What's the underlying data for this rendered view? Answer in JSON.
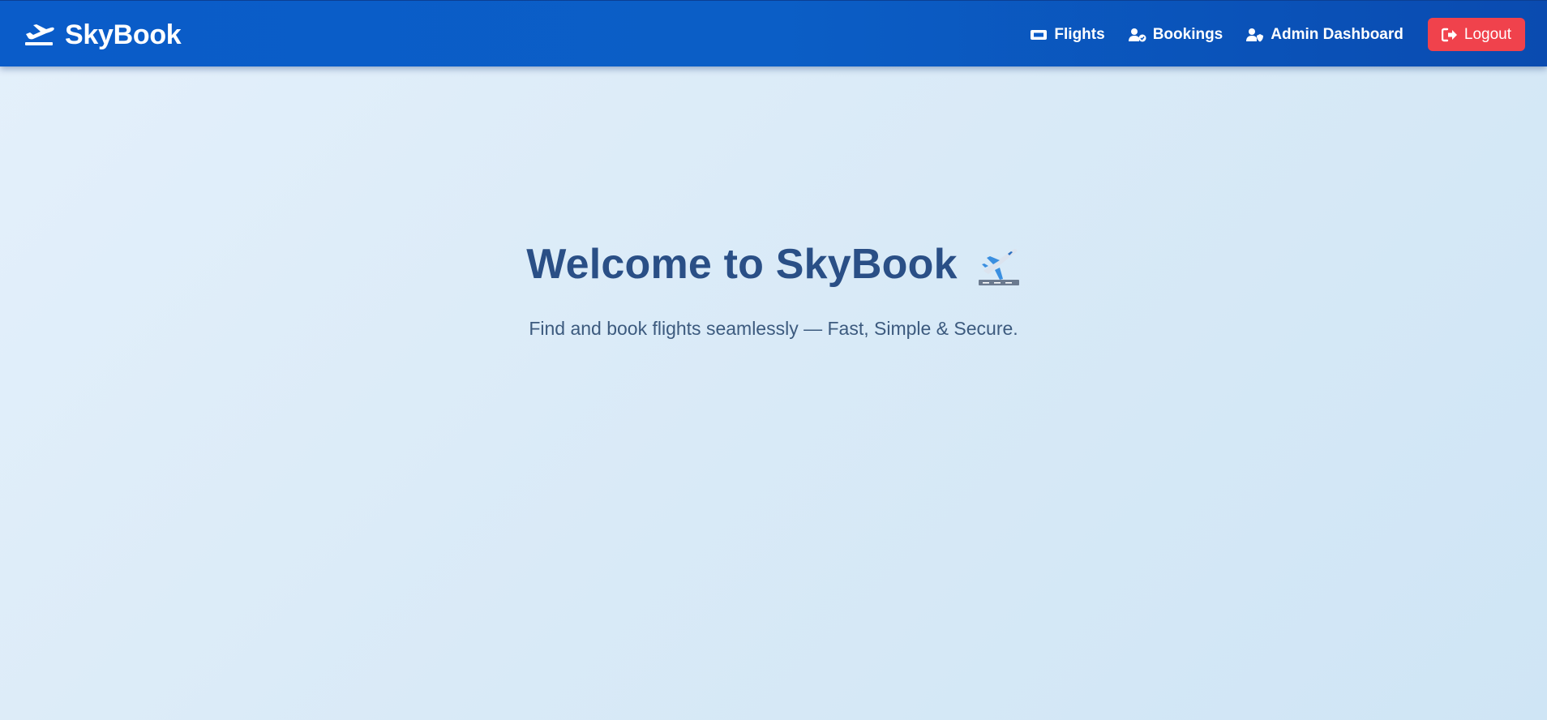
{
  "brand": {
    "name": "SkyBook",
    "icon": "plane-departure-icon"
  },
  "nav": {
    "items": [
      {
        "label": "Flights",
        "icon": "ticket-icon"
      },
      {
        "label": "Bookings",
        "icon": "user-check-icon"
      },
      {
        "label": "Admin Dashboard",
        "icon": "user-shield-icon"
      }
    ],
    "logout_label": "Logout",
    "logout_icon": "sign-out-icon"
  },
  "hero": {
    "title": "Welcome to SkyBook",
    "emoji": "airplane-departure-emoji",
    "subtitle": "Find and book flights seamlessly — Fast, Simple & Secure."
  },
  "colors": {
    "navbar": "#0a5cc9",
    "logout": "#f0424c",
    "title": "#2a4f86",
    "subtitle": "#3c5a7e",
    "background": "#dcebf8"
  }
}
